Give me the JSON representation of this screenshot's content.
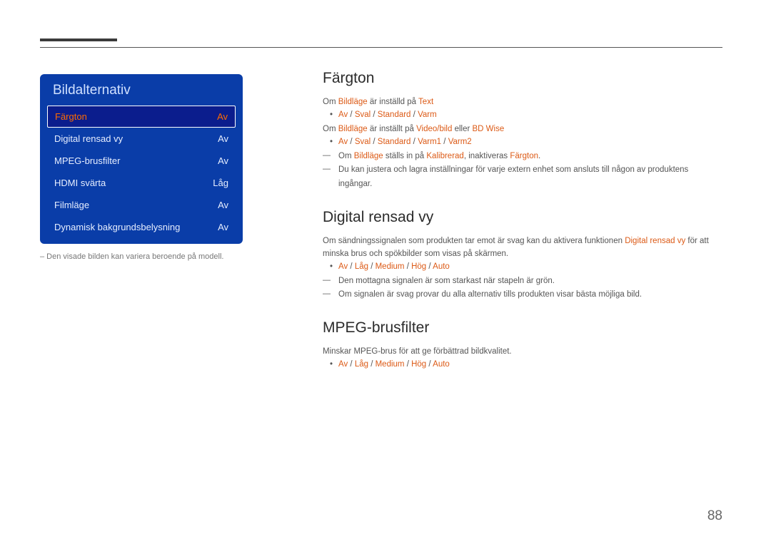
{
  "menu": {
    "title": "Bildalternativ",
    "items": [
      {
        "label": "Färgton",
        "value": "Av",
        "selected": true
      },
      {
        "label": "Digital rensad vy",
        "value": "Av",
        "selected": false
      },
      {
        "label": "MPEG-brusfilter",
        "value": "Av",
        "selected": false
      },
      {
        "label": "HDMI svärta",
        "value": "Låg",
        "selected": false
      },
      {
        "label": "Filmläge",
        "value": "Av",
        "selected": false
      },
      {
        "label": "Dynamisk bakgrundsbelysning",
        "value": "Av",
        "selected": false
      }
    ],
    "note": "–  Den visade bilden kan variera beroende på modell."
  },
  "sections": {
    "fargton": {
      "heading": "Färgton",
      "line1a": "Om ",
      "line1b": "Bildläge",
      "line1c": " är inställd på ",
      "line1d": "Text",
      "opt1": {
        "a": "Av",
        "b": "Sval",
        "c": "Standard",
        "d": "Varm"
      },
      "line2a": "Om ",
      "line2b": "Bildläge",
      "line2c": " är inställt på ",
      "line2d": "Video/bild",
      "line2e": " eller ",
      "line2f": "BD Wise",
      "opt2": {
        "a": "Av",
        "b": "Sval",
        "c": "Standard",
        "d": "Varm1",
        "e": "Varm2"
      },
      "dash1a": "Om ",
      "dash1b": "Bildläge",
      "dash1c": " ställs in på ",
      "dash1d": "Kalibrerad",
      "dash1e": ", inaktiveras ",
      "dash1f": "Färgton",
      "dash1g": ".",
      "dash2": "Du kan justera och lagra inställningar för varje extern enhet som ansluts till någon av produktens ingångar."
    },
    "digital": {
      "heading": "Digital rensad vy",
      "p1a": "Om sändningssignalen som produkten tar emot är svag kan du aktivera funktionen ",
      "p1b": "Digital rensad vy",
      "p1c": " för att minska brus och spökbilder som visas på skärmen.",
      "opt": {
        "a": "Av",
        "b": "Låg",
        "c": "Medium",
        "d": "Hög",
        "e": "Auto"
      },
      "dash1": "Den mottagna signalen är som starkast när stapeln är grön.",
      "dash2": "Om signalen är svag provar du alla alternativ tills produkten visar bästa möjliga bild."
    },
    "mpeg": {
      "heading": "MPEG-brusfilter",
      "p1": "Minskar MPEG-brus för att ge förbättrad bildkvalitet.",
      "opt": {
        "a": "Av",
        "b": "Låg",
        "c": "Medium",
        "d": "Hög",
        "e": "Auto"
      }
    }
  },
  "page": "88"
}
